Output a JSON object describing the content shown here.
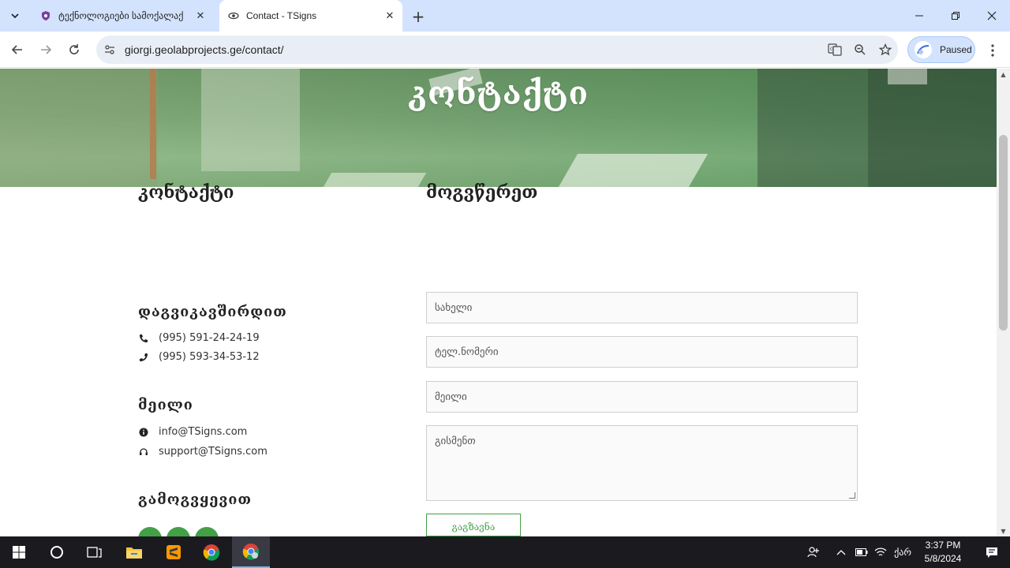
{
  "browser": {
    "tabs": [
      {
        "title": "ტექნოლოგიები სამოქალაქ",
        "active": false
      },
      {
        "title": "Contact - TSigns",
        "active": true
      }
    ],
    "url": "giorgi.geolabprojects.ge/contact/",
    "profile_label": "Paused"
  },
  "page": {
    "hero_title": "კონტაქტი",
    "contact_heading": "კონტაქტი",
    "connect_heading": "დაგვიკავშირდით",
    "phones": [
      "(995) 591-24-24-19",
      "(995) 593-34-53-12"
    ],
    "mail_heading": "მეილი",
    "emails": [
      "info@TSigns.com",
      "support@TSigns.com"
    ],
    "follow_heading": "გამოგვყევით",
    "form": {
      "heading": "მოგვწერეთ",
      "name_placeholder": "სახელი",
      "phone_placeholder": "ტელ.ნომერი",
      "email_placeholder": "მეილი",
      "message_placeholder": "გისმენთ",
      "send_label": "გაგზავნა"
    }
  },
  "taskbar": {
    "time": "3:37 PM",
    "date": "5/8/2024",
    "lang": "ქარ"
  },
  "colors": {
    "accent_green": "#43a047",
    "tab_bar": "#d3e3fd"
  }
}
